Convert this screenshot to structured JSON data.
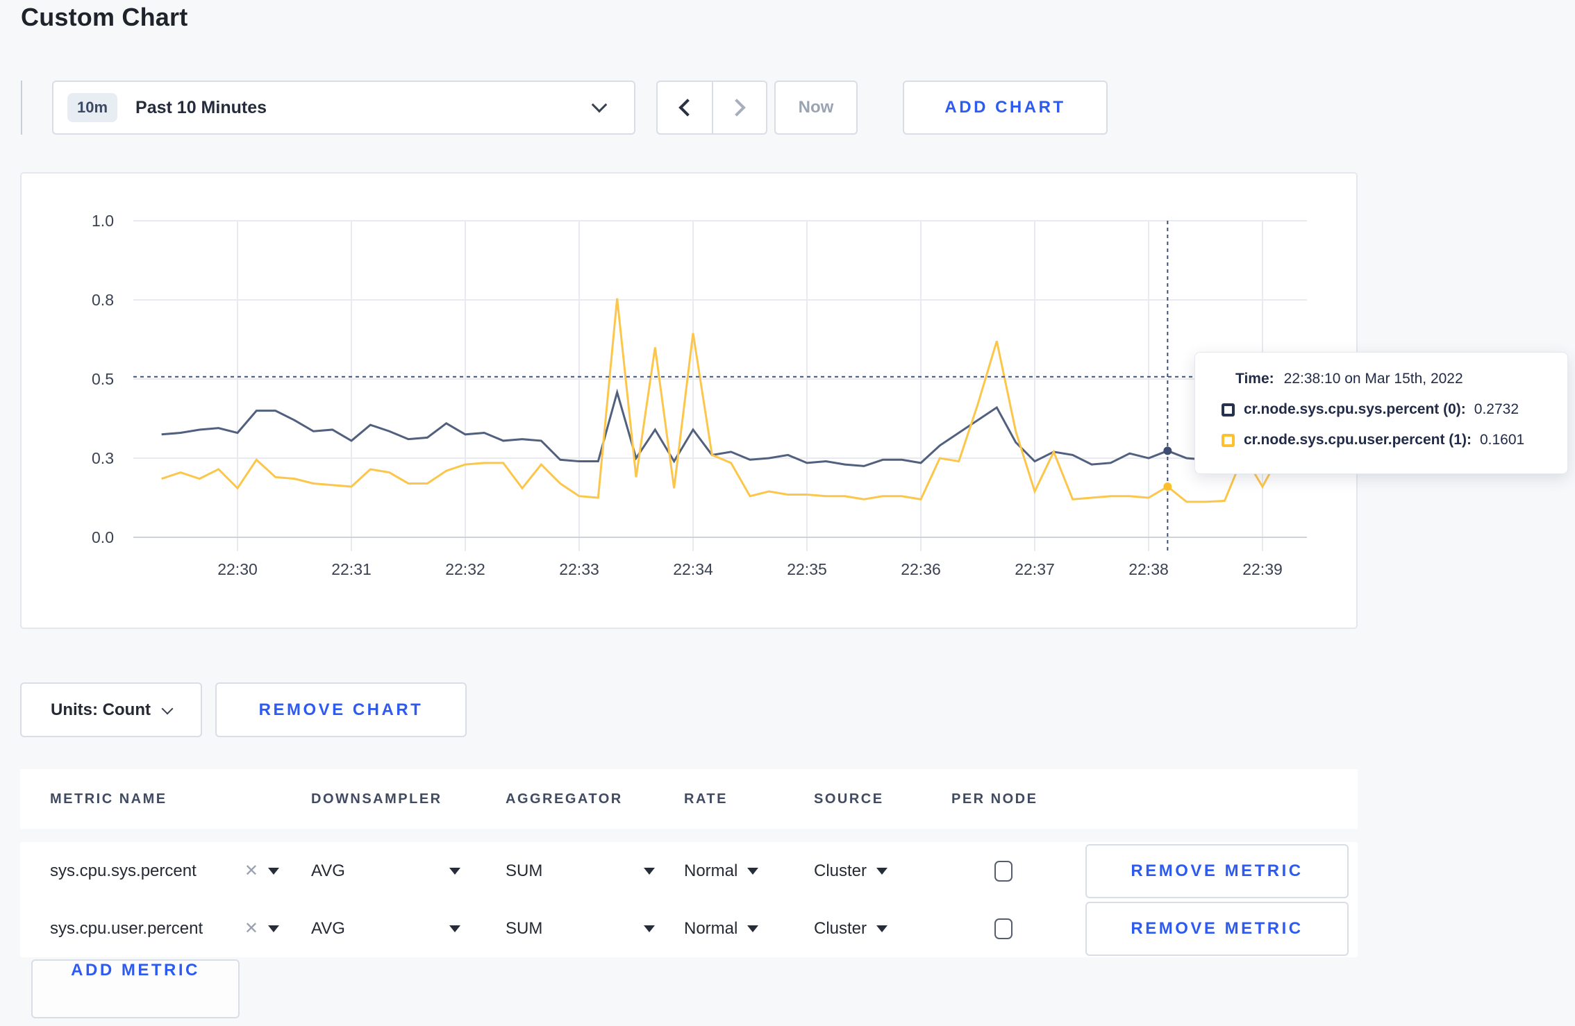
{
  "page": {
    "title": "Custom Chart",
    "background_color": "#f7f8fa",
    "accent_blue": "#2d5af1"
  },
  "toolbar": {
    "time_window_badge": "10m",
    "time_window_label": "Past 10 Minutes",
    "now_label": "Now",
    "add_chart_label": "ADD CHART"
  },
  "chart_data": {
    "type": "line",
    "title": "",
    "xlabel": "",
    "ylabel": "",
    "ylim": [
      0,
      1
    ],
    "grid": true,
    "x_tick_labels": [
      "22:30",
      "22:31",
      "22:32",
      "22:33",
      "22:34",
      "22:35",
      "22:36",
      "22:37",
      "22:38",
      "22:39"
    ],
    "y_ticks": [
      {
        "value": 0,
        "label": "0.0"
      },
      {
        "value": 0.25,
        "label": "0.3"
      },
      {
        "value": 0.5,
        "label": "0.5"
      },
      {
        "value": 0.75,
        "label": "0.8"
      },
      {
        "value": 1.0,
        "label": "1.0"
      }
    ],
    "start_time": "22:29:20",
    "point_interval_seconds": 10,
    "series": [
      {
        "name": "cr.node.sys.cpu.sys.percent (0)",
        "color": "#51607e",
        "values": [
          0.325,
          0.33,
          0.34,
          0.345,
          0.33,
          0.4,
          0.4,
          0.37,
          0.335,
          0.34,
          0.305,
          0.355,
          0.335,
          0.31,
          0.315,
          0.36,
          0.325,
          0.33,
          0.305,
          0.31,
          0.305,
          0.245,
          0.24,
          0.24,
          0.458,
          0.25,
          0.34,
          0.24,
          0.34,
          0.26,
          0.27,
          0.245,
          0.25,
          0.26,
          0.235,
          0.24,
          0.23,
          0.225,
          0.245,
          0.245,
          0.235,
          0.29,
          0.33,
          0.37,
          0.41,
          0.3,
          0.24,
          0.27,
          0.26,
          0.23,
          0.235,
          0.265,
          0.25,
          0.2732,
          0.25,
          0.245,
          0.25,
          0.255,
          0.25,
          0.255
        ]
      },
      {
        "name": "cr.node.sys.cpu.user.percent (1)",
        "color": "#fcc64b",
        "values": [
          0.185,
          0.205,
          0.185,
          0.215,
          0.155,
          0.245,
          0.19,
          0.185,
          0.17,
          0.165,
          0.16,
          0.215,
          0.205,
          0.17,
          0.17,
          0.21,
          0.23,
          0.235,
          0.235,
          0.155,
          0.23,
          0.17,
          0.13,
          0.125,
          0.755,
          0.19,
          0.6,
          0.155,
          0.645,
          0.26,
          0.235,
          0.13,
          0.145,
          0.135,
          0.135,
          0.13,
          0.13,
          0.12,
          0.13,
          0.13,
          0.12,
          0.25,
          0.24,
          0.42,
          0.62,
          0.335,
          0.145,
          0.27,
          0.12,
          0.125,
          0.13,
          0.13,
          0.125,
          0.1601,
          0.112,
          0.112,
          0.115,
          0.26,
          0.16,
          0.27
        ]
      }
    ],
    "crosshair": {
      "time": "22:38:10",
      "offset_seconds": 530,
      "hover_value": 0.507,
      "color": "#41506e"
    },
    "highlight_points": [
      {
        "series": 0,
        "time": "22:38:10",
        "value": 0.2732,
        "color": "#3d4d6d"
      },
      {
        "series": 1,
        "time": "22:38:10",
        "value": 0.1601,
        "color": "#fcbf2d"
      }
    ],
    "legend_position": "tooltip-overlay"
  },
  "tooltip": {
    "time_label": "Time:",
    "time_value": "22:38:10 on Mar 15th, 2022",
    "entries": [
      {
        "label": "cr.node.sys.cpu.sys.percent (0):",
        "value": "0.2732",
        "swatch_color": "#26314e"
      },
      {
        "label": "cr.node.sys.cpu.user.percent (1):",
        "value": "0.1601",
        "swatch_color": "#fdc02f"
      }
    ]
  },
  "chart_controls": {
    "units_label": "Units: Count",
    "remove_chart_label": "REMOVE CHART"
  },
  "metrics_table": {
    "headers": [
      "METRIC NAME",
      "DOWNSAMPLER",
      "AGGREGATOR",
      "RATE",
      "SOURCE",
      "PER NODE"
    ],
    "rows": [
      {
        "metric_name": "sys.cpu.sys.percent",
        "downsampler": "AVG",
        "aggregator": "SUM",
        "rate": "Normal",
        "source": "Cluster",
        "per_node_checked": false,
        "remove_label": "REMOVE METRIC"
      },
      {
        "metric_name": "sys.cpu.user.percent",
        "downsampler": "AVG",
        "aggregator": "SUM",
        "rate": "Normal",
        "source": "Cluster",
        "per_node_checked": false,
        "remove_label": "REMOVE METRIC"
      }
    ],
    "add_metric_label": "ADD METRIC"
  }
}
